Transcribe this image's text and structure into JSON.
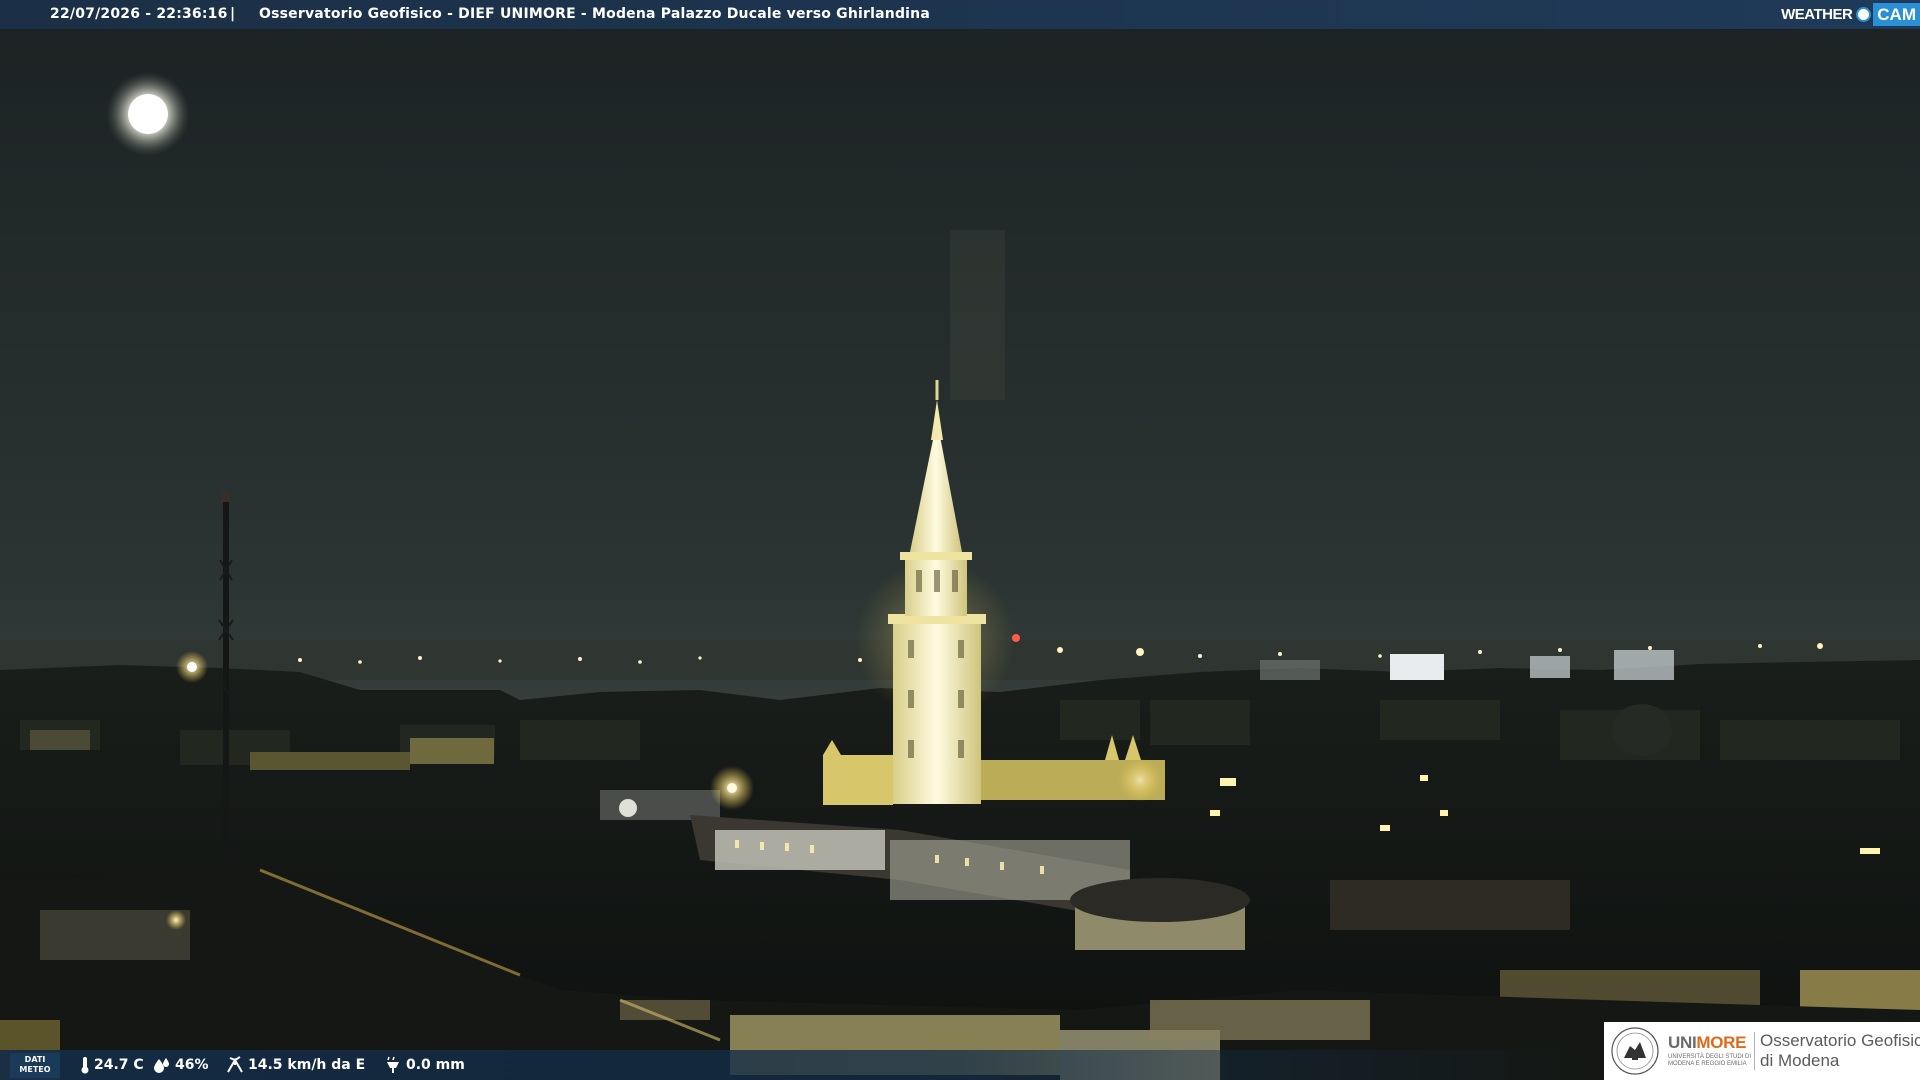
{
  "header": {
    "timestamp": "22/07/2026 - 22:36:16",
    "separator": "|",
    "caption": "Osservatorio Geofisico - DIEF UNIMORE - Modena Palazzo Ducale verso Ghirlandina",
    "logo_word": "WEATHER",
    "logo_cam": "CAM"
  },
  "weather": {
    "tag_line1": "DATI",
    "tag_line2": "METEO",
    "temperature": "24.7 C",
    "humidity": "46%",
    "wind": "14.5 km/h da E",
    "rain": "0.0 mm",
    "icons": [
      "thermometer-icon",
      "humidity-drop-icon",
      "wind-icon",
      "rain-gauge-icon"
    ]
  },
  "branding": {
    "uni_name_a": "UNI",
    "uni_name_b": "MORE",
    "uni_sub": "UNIVERSITÀ DEGLI STUDI DI MODENA E REGGIO EMILIA",
    "obs_line1": "Osservatorio Geofisico",
    "obs_line2": "di Modena",
    "accent": "#e06a1a",
    "logo_blue": "#2a8fd4"
  },
  "colors": {
    "sky_top": "#1e2526",
    "sky_horizon": "#3a4440",
    "tower_light": "#fff6c8",
    "lamp": "#ffe27a"
  }
}
